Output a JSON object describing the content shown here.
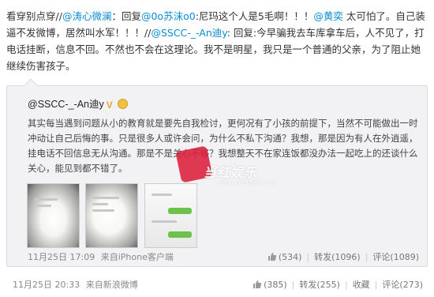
{
  "post": {
    "segments": [
      {
        "text": "看穿别点穿",
        "kind": "plain"
      },
      {
        "text": "//",
        "kind": "plain"
      },
      {
        "text": "@涛心微澜",
        "kind": "link"
      },
      {
        "text": "：回复",
        "kind": "plain"
      },
      {
        "text": "@0o苏沫o0",
        "kind": "link"
      },
      {
        "text": ":尼玛这个人是5毛啊！！！",
        "kind": "plain"
      },
      {
        "text": "@黄奕",
        "kind": "link"
      },
      {
        "text": " 太可怕了。自己装逼不发微博，居然叫水军！！！",
        "kind": "plain"
      },
      {
        "text": "//",
        "kind": "plain"
      },
      {
        "text": "@SSCC-_-An迪y",
        "kind": "link"
      },
      {
        "text": ": 回复:今早骗我去车库拿车后，人不见了，打电话挂断，信息不回。不然也不会在这理论。我不是明星，我只是一个普通的父亲，为了阻止她继续伤害孩子。",
        "kind": "plain"
      }
    ],
    "time": "11月25日 20:33",
    "source": "来自新浪微博",
    "actions": {
      "like": "(385)",
      "repost": "转发(255)",
      "favorite": "收藏",
      "comment": "评论(273)"
    }
  },
  "quote": {
    "author": "@SSCC-_-An迪y",
    "text": "其实每当遇到问题从小的教育就是要先自我检讨，更何况有了小孩的前提下，当然不可能做出一时冲动让自己后悔的事。只是很多人或许会问，为什么不私下沟通？我想，那是因为有人在外逍遥，挂电话不回信息无从沟通。那是不是关心不够？我想整天不在家连饭都没办法一起吃上的还谈什么关心，能见到都不错了。",
    "time": "11月25日 17:09",
    "source": "来自iPhone客户端",
    "actions": {
      "like": "(534)",
      "repost": "转发(1096)",
      "comment": "评论(1089)"
    }
  },
  "watermark": {
    "main": "当红娱乐",
    "sub": "ent.rednet.cn"
  },
  "colors": {
    "link": "#0a8cd2",
    "quote_bg": "#f2f2f5",
    "seal": "#dc1e3c"
  }
}
